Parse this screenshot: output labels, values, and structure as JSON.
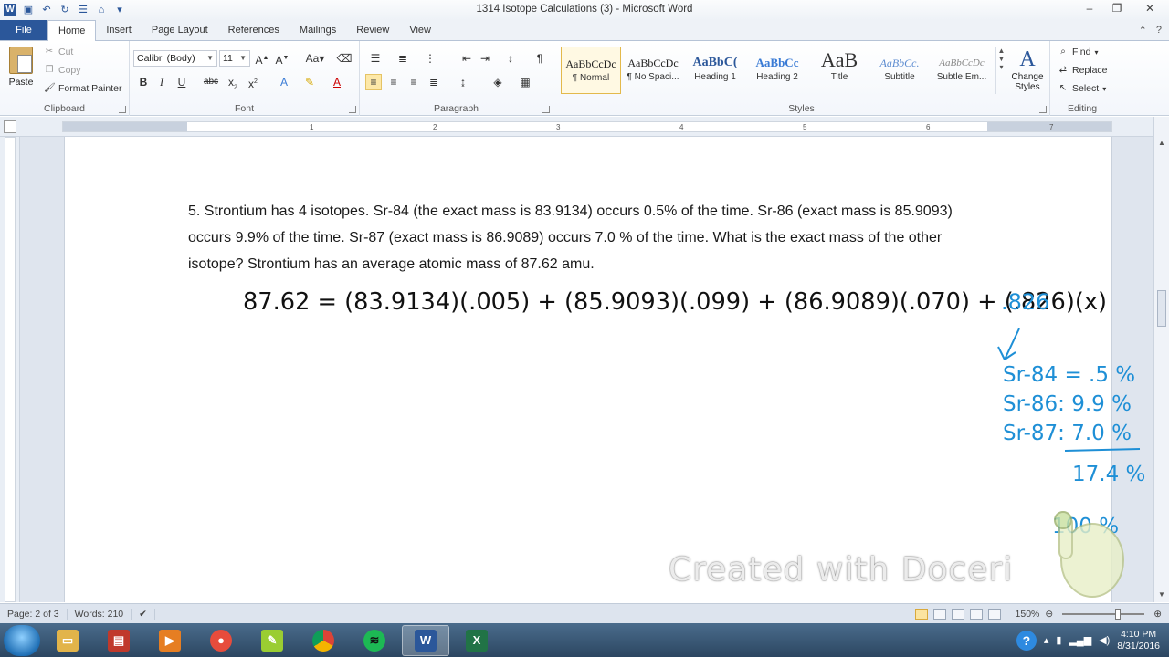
{
  "window": {
    "title": "1314 Isotope Calculations (3) - Microsoft Word",
    "controls": [
      "–",
      "❐",
      "✕"
    ]
  },
  "tabs": [
    "File",
    "Home",
    "Insert",
    "Page Layout",
    "References",
    "Mailings",
    "Review",
    "View"
  ],
  "active_tab": "Home",
  "ribbon": {
    "clipboard": {
      "label": "Clipboard",
      "paste": "Paste",
      "cut": "Cut",
      "copy": "Copy",
      "format_painter": "Format Painter"
    },
    "font": {
      "label": "Font",
      "font_name": "Calibri (Body)",
      "font_size": "11"
    },
    "paragraph": {
      "label": "Paragraph"
    },
    "styles": {
      "label": "Styles",
      "items": [
        {
          "sample": "AaBbCcDc",
          "name": "¶ Normal"
        },
        {
          "sample": "AaBbCcDc",
          "name": "¶ No Spaci..."
        },
        {
          "sample": "AaBbC(",
          "name": "Heading 1"
        },
        {
          "sample": "AaBbCc",
          "name": "Heading 2"
        },
        {
          "sample": "AaB",
          "name": "Title"
        },
        {
          "sample": "AaBbCc.",
          "name": "Subtitle"
        },
        {
          "sample": "AaBbCcDc",
          "name": "Subtle Em..."
        }
      ],
      "change_styles": "Change Styles"
    },
    "editing": {
      "label": "Editing",
      "find": "Find",
      "replace": "Replace",
      "select": "Select"
    }
  },
  "ruler_ticks": [
    "1",
    "2",
    "3",
    "4",
    "5",
    "6",
    "7"
  ],
  "document": {
    "question": "5.  Strontium has 4 isotopes.  Sr-84 (the exact mass is 83.9134) occurs 0.5% of the time.  Sr-86 (exact mass is 85.9093) occurs 9.9% of the time.  Sr-87 (exact mass is 86.9089) occurs 7.0 % of the time.  What is the exact mass of the other isotope?  Strontium has an average atomic mass of 87.62 amu.",
    "equation": "87.62 = (83.9134)(.005) + (85.9093)(.099) + (86.9089)(.070) + (.826)(x)",
    "annotations": {
      "abundance": ".826",
      "sum_lines": [
        "Sr-84 = .5 %",
        "Sr-86: 9.9 %",
        "Sr-87: 7.0 %"
      ],
      "sum_total": "17.4 %",
      "hundred": "100 %"
    }
  },
  "watermark": "Created with Doceri",
  "status": {
    "page": "Page: 2 of 3",
    "words": "Words: 210",
    "zoom": "150%"
  },
  "clock": {
    "time": "4:10 PM",
    "date": "8/31/2016"
  },
  "colors": {
    "ink_black": "#111111",
    "ink_blue": "#1e8fd6",
    "word_blue": "#2b579a"
  }
}
